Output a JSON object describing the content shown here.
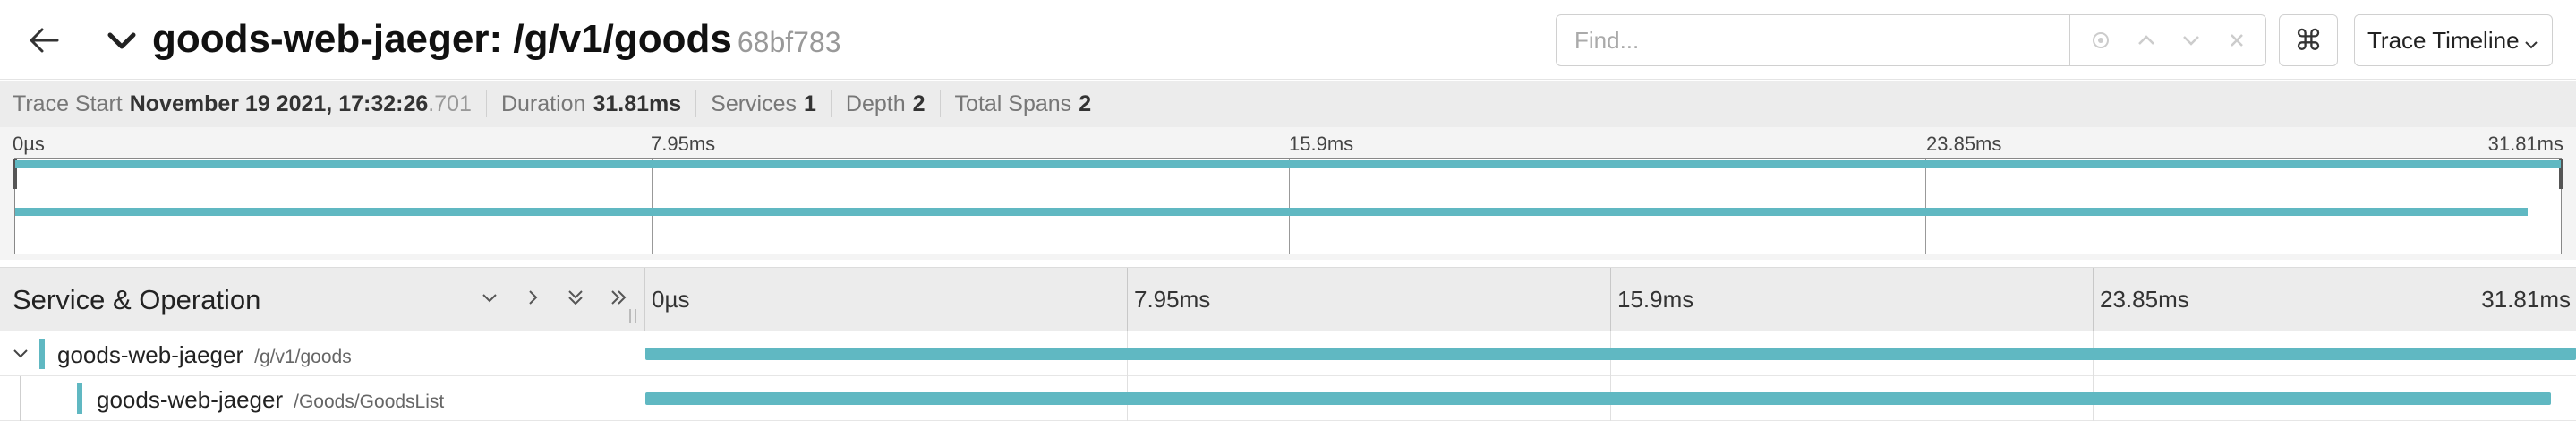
{
  "header": {
    "title": "goods-web-jaeger: /g/v1/goods",
    "trace_id": "68bf783",
    "search_placeholder": "Find...",
    "kbd_symbol": "⌘",
    "view_mode": "Trace Timeline"
  },
  "summary": {
    "trace_start_label": "Trace Start",
    "trace_start_value": "November 19 2021, 17:32:26",
    "trace_start_ms": ".701",
    "duration_label": "Duration",
    "duration_value": "31.81ms",
    "services_label": "Services",
    "services_value": "1",
    "depth_label": "Depth",
    "depth_value": "2",
    "total_spans_label": "Total Spans",
    "total_spans_value": "2"
  },
  "minimap": {
    "ticks": [
      "0µs",
      "7.95ms",
      "15.9ms",
      "23.85ms",
      "31.81ms"
    ]
  },
  "timeline": {
    "column_title": "Service & Operation",
    "ticks": [
      "0µs",
      "7.95ms",
      "15.9ms",
      "23.85ms",
      "31.81ms"
    ],
    "total_duration_ms": 31.81
  },
  "spans": [
    {
      "service": "goods-web-jaeger",
      "operation": "/g/v1/goods",
      "depth": 0,
      "start_ms": 0,
      "duration_ms": 31.81,
      "color": "#60b8c2"
    },
    {
      "service": "goods-web-jaeger",
      "operation": "/Goods/GoodsList",
      "depth": 1,
      "start_ms": 0,
      "duration_ms": 31.4,
      "color": "#60b8c2"
    }
  ],
  "colors": {
    "accent": "#60b8c2"
  }
}
